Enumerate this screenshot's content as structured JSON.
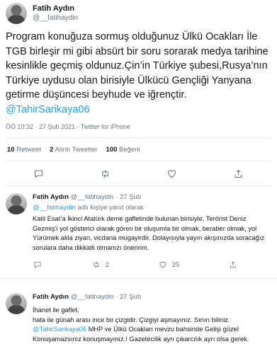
{
  "main_tweet": {
    "author_name": "Fatih Aydın",
    "author_handle": "@__fatihaydin",
    "text": "Program konuğuza sormuş olduğunuz Ülkü Ocakları İle TGB birleşir mi gibi absürt bir soru sorarak medya tarihine kesinlikle geçmiş oldunuz.Çin’in Türkiye şubesi,Rusya’nın Türkiye uydusu olan birisiyle Ülkücü Gençliği Yanyana getirme düşüncesi beyhude ve iğrençtir.",
    "mention": "@TahirSarikaya06",
    "meta": "ÖÖ 10:32 · 27 Şub 2021 · Twitter for iPhone",
    "retweets_count": "10",
    "retweets_label": "Retweet",
    "quotes_count": "2",
    "quotes_label": "Alıntı Tweetler",
    "likes_count": "100",
    "likes_label": "Beğeni"
  },
  "replies": [
    {
      "author_name": "Fatih Aydın",
      "author_handle": "@__fatihaydin",
      "date": "· 27 Şub",
      "replying_handle": "@__fatihaydin",
      "replying_suffix": " adlı kişiye yanıt olarak",
      "text": "Katil Esat’a İkinci Atatürk deme gafletinde bulunan birisiyle, Terörist Deniz Gezmiş’i yol gösterici olarak gören bir oluşumla bir olmak, beraber olmak, yol Yürümek akla ziyan, vicdana mugayirdir. Dolayısıyla yayın akışınızda soracağız sorulara daha dikkatli olmanızı öneririm.",
      "retweets": "2",
      "likes": "25"
    },
    {
      "author_name": "Fatih Aydın",
      "author_handle": "@__fatihaydin",
      "date": "· 27 Şub",
      "line1": "İhanet ile gaflet,",
      "line2": "hata ile günah arası ince bir çizgidir. Çizgiyi aşmayınız. Sınırı biliniz.",
      "mention": "@TahirSarikaya06",
      "line3_rest": " MHP ve Ülkü Ocakları mevzu bahsinde Gelişi güzel Konuşamazsınız konuşmayınız.! Gazetecilik ayrı çıkarcılık ayrı olsa gerek."
    }
  ],
  "colors": {
    "accent": "#1da1f2",
    "muted": "#657786",
    "text": "#14171a",
    "divider": "#e6ecf0"
  }
}
